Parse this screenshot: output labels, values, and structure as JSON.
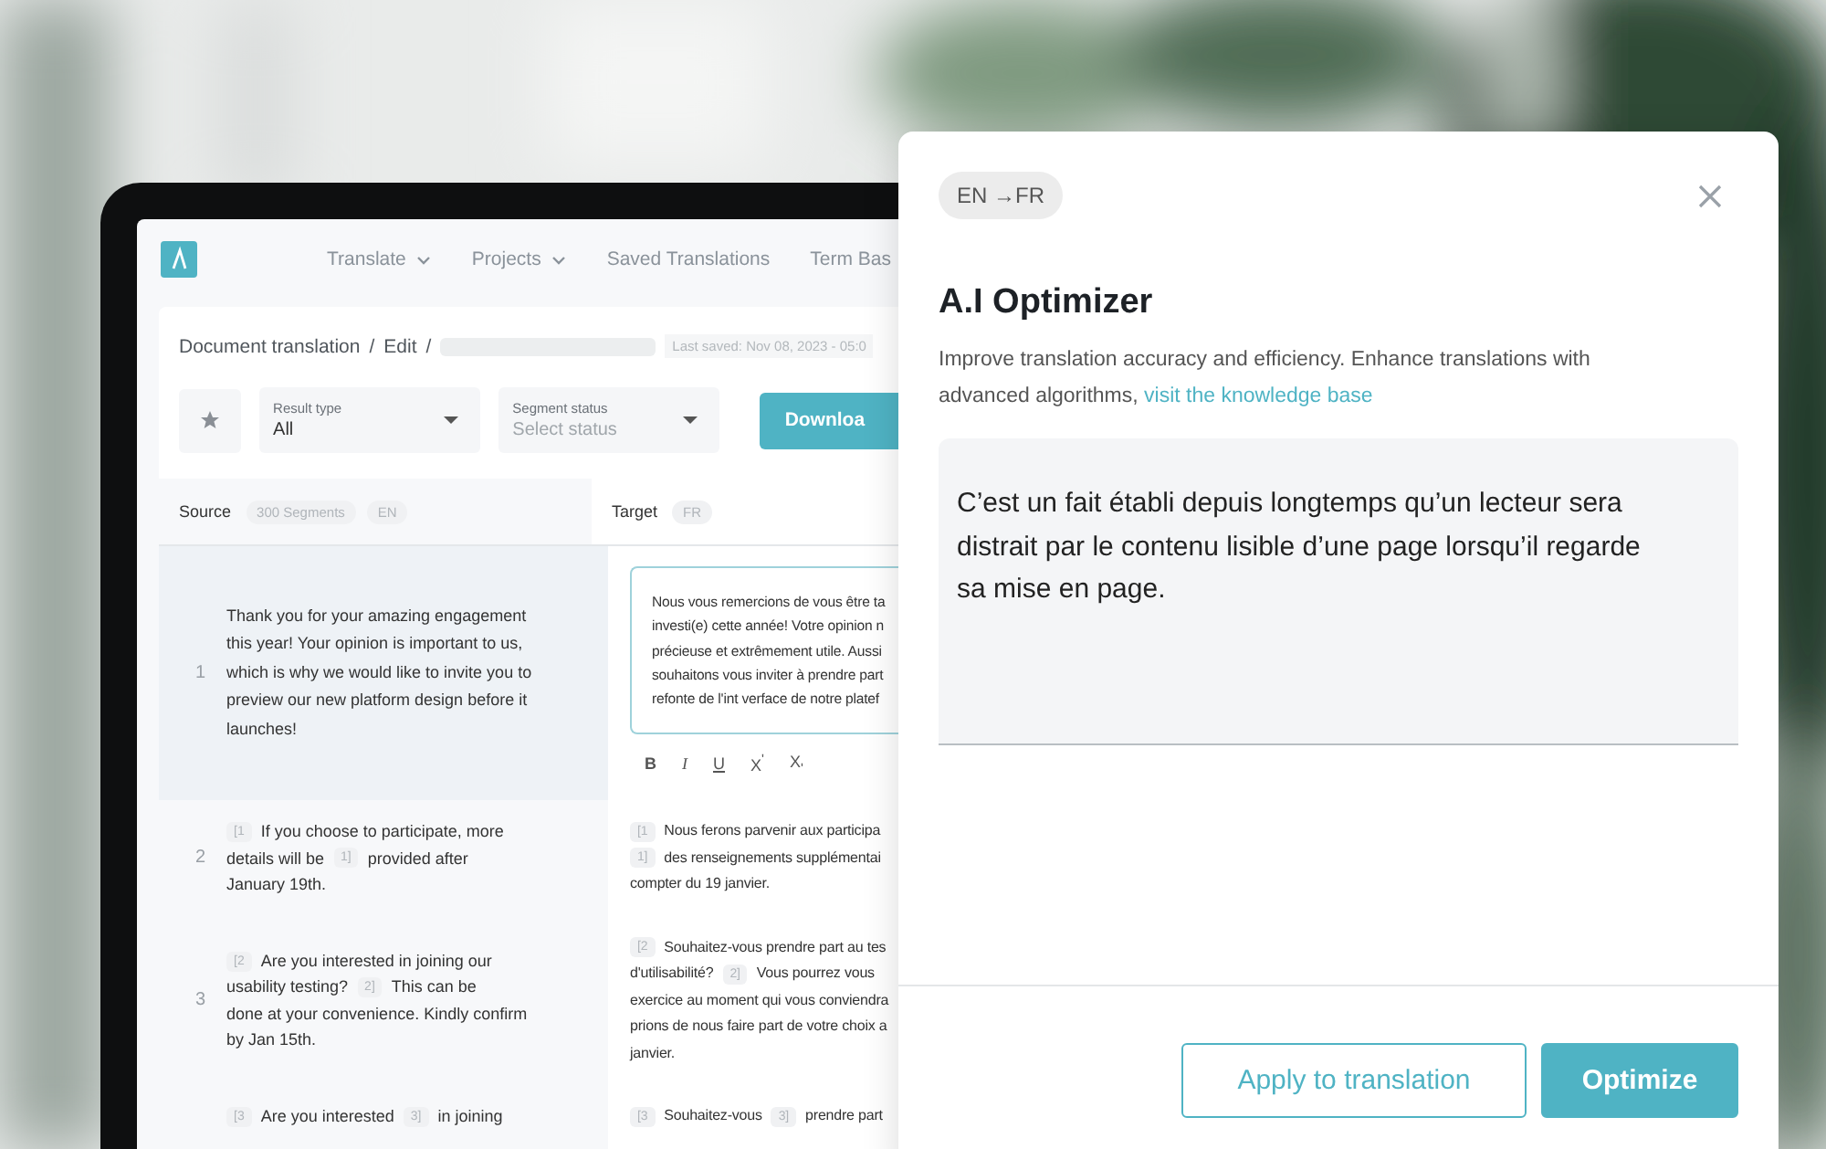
{
  "nav": {
    "items": [
      {
        "label": "Translate",
        "dropdown": true
      },
      {
        "label": "Projects",
        "dropdown": true
      },
      {
        "label": "Saved Translations",
        "dropdown": false
      },
      {
        "label": "Term Bas",
        "dropdown": false
      }
    ]
  },
  "breadcrumb": [
    {
      "kind": "link",
      "text": "Document translation"
    },
    {
      "kind": "separator",
      "text": "/"
    },
    {
      "kind": "link",
      "text": "Edit"
    },
    {
      "kind": "separator",
      "text": "/"
    },
    {
      "kind": "redacted"
    }
  ],
  "last_saved": "Last saved: Nov 08, 2023 - 05:0",
  "filters": [
    {
      "label": "Result type",
      "value": "All"
    },
    {
      "label": "Segment status",
      "placeholder": "Select status"
    }
  ],
  "download_button": "Downloa",
  "columns": {
    "source": {
      "title": "Source",
      "badges": [
        "300 Segments",
        "EN"
      ]
    },
    "target": {
      "title": "Target",
      "badges": [
        "FR"
      ]
    }
  },
  "format_buttons": [
    "B",
    "I",
    "U",
    "X$^{'}$",
    "X$_{'}$"
  ],
  "rows": [
    {
      "number": "1",
      "selected": true,
      "source": [
        [
          {
            "kind": "text",
            "text": "Thank you for your amazing engagement"
          }
        ],
        [
          {
            "kind": "text",
            "text": "this year! Your opinion is important to us,"
          }
        ],
        [
          {
            "kind": "text",
            "text": "which is why we would like to invite you to"
          }
        ],
        [
          {
            "kind": "text",
            "text": "preview our new platform design before it"
          }
        ],
        [
          {
            "kind": "text",
            "text": "launches!"
          }
        ]
      ],
      "target": [
        [
          {
            "kind": "text",
            "text": "Nous vous remercions de vous être ta"
          }
        ],
        [
          {
            "kind": "text",
            "text": "investi(e) cette année! Votre opinion n"
          }
        ],
        [
          {
            "kind": "text",
            "text": "précieuse et extrêmement utile. Aussi"
          }
        ],
        [
          {
            "kind": "text",
            "text": "souhaitons vous inviter à prendre part"
          }
        ],
        [
          {
            "kind": "text",
            "text": "refonte de l'int verface de notre platef"
          }
        ]
      ]
    },
    {
      "number": "2",
      "selected": false,
      "source": [
        [
          {
            "kind": "tag",
            "text": "[1"
          },
          {
            "kind": "text",
            "text": "If you choose to participate, more"
          }
        ],
        [
          {
            "kind": "text",
            "text": "details will be"
          },
          {
            "kind": "tag",
            "text": "1]"
          },
          {
            "kind": "text",
            "text": "provided after"
          }
        ],
        [
          {
            "kind": "text",
            "text": "January 19th."
          }
        ]
      ],
      "target": [
        [
          {
            "kind": "tag",
            "text": "[1"
          },
          {
            "kind": "text",
            "text": "Nous ferons parvenir aux participa"
          }
        ],
        [
          {
            "kind": "tag",
            "text": "1]"
          },
          {
            "kind": "text",
            "text": "des renseignements supplémentai"
          }
        ],
        [
          {
            "kind": "text",
            "text": "compter du 19 janvier."
          }
        ]
      ]
    },
    {
      "number": "3",
      "selected": false,
      "source": [
        [
          {
            "kind": "tag",
            "text": "[2"
          },
          {
            "kind": "text",
            "text": "Are you interested in joining our"
          }
        ],
        [
          {
            "kind": "text",
            "text": "usability testing?"
          },
          {
            "kind": "tag",
            "text": "2]"
          },
          {
            "kind": "text",
            "text": "This can be"
          }
        ],
        [
          {
            "kind": "text",
            "text": "done at your convenience. Kindly confirm"
          }
        ],
        [
          {
            "kind": "text",
            "text": "by Jan 15th."
          }
        ]
      ],
      "target": [
        [
          {
            "kind": "tag",
            "text": "[2"
          },
          {
            "kind": "text",
            "text": "Souhaitez-vous prendre part au tes"
          }
        ],
        [
          {
            "kind": "text",
            "text": "d'utilisabilité?"
          },
          {
            "kind": "tag",
            "text": "2]"
          },
          {
            "kind": "text",
            "text": "Vous pourrez vous"
          }
        ],
        [
          {
            "kind": "text",
            "text": "exercice au moment qui vous conviendra"
          }
        ],
        [
          {
            "kind": "text",
            "text": "prions de nous faire part de votre choix a"
          }
        ],
        [
          {
            "kind": "text",
            "text": "janvier."
          }
        ]
      ]
    },
    {
      "number": "",
      "selected": false,
      "source": [
        [
          {
            "kind": "tag",
            "text": "[3"
          },
          {
            "kind": "text",
            "text": "Are you interested"
          },
          {
            "kind": "tag",
            "text": "3]"
          },
          {
            "kind": "text",
            "text": "in joining"
          }
        ]
      ],
      "target": [
        [
          {
            "kind": "tag",
            "text": "[3"
          },
          {
            "kind": "text",
            "text": "Souhaitez-vous"
          },
          {
            "kind": "tag",
            "text": "3]"
          },
          {
            "kind": "text",
            "text": "prendre part"
          }
        ]
      ]
    }
  ],
  "modal": {
    "language_pair": "EN →FR",
    "title": "A.I Optimizer",
    "description": "Improve translation accuracy and efficiency. Enhance translations with advanced algorithms, ",
    "link": "visit the knowledge base",
    "value": "C’est un fait établi depuis longtemps qu’un lecteur sera distrait par le contenu lisible d’une page lorsqu’il regarde sa mise en page.",
    "buttons": [
      {
        "label": "Apply to translation",
        "kind": "outline"
      },
      {
        "label": "Optimize",
        "kind": "primary"
      }
    ]
  }
}
